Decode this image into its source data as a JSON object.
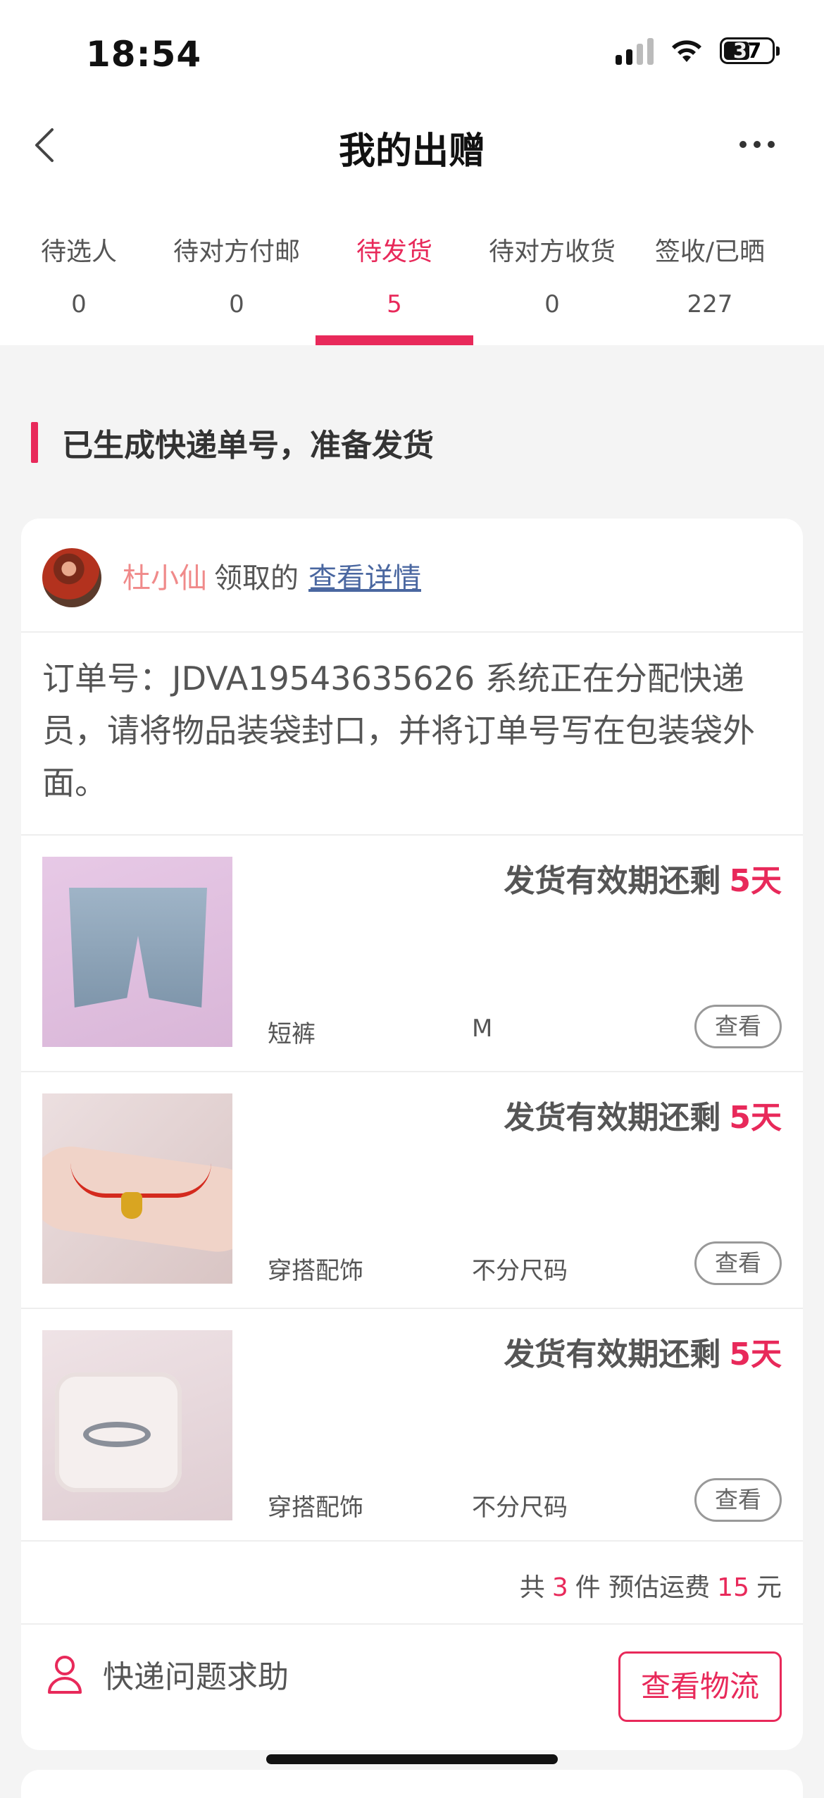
{
  "status_bar": {
    "time": "18:54",
    "battery": "37"
  },
  "nav": {
    "title": "我的出赠"
  },
  "tabs": [
    {
      "label": "待选人",
      "count": "0"
    },
    {
      "label": "待对方付邮",
      "count": "0"
    },
    {
      "label": "待发货",
      "count": "5",
      "active": true
    },
    {
      "label": "待对方收货",
      "count": "0"
    },
    {
      "label": "签收/已晒",
      "count": "227"
    }
  ],
  "section": {
    "title": "已生成快递单号，准备发货"
  },
  "card": {
    "giver_name": "杜小仙",
    "claim_text": "领取的",
    "detail_link": "查看详情",
    "order_info": "订单号：JDVA19543635626 系统正在分配快递员，请将物品装袋封口，并将订单号写在包装袋外面。",
    "items": [
      {
        "deadline_label": "发货有效期还剩",
        "days": "5天",
        "category": "短裤",
        "size": "M",
        "view_label": "查看"
      },
      {
        "deadline_label": "发货有效期还剩",
        "days": "5天",
        "category": "穿搭配饰",
        "size": "不分尺码",
        "view_label": "查看"
      },
      {
        "deadline_label": "发货有效期还剩",
        "days": "5天",
        "category": "穿搭配饰",
        "size": "不分尺码",
        "view_label": "查看"
      }
    ],
    "summary": {
      "prefix": "共",
      "count": "3",
      "unit": "件 预估运费",
      "fee": "15",
      "currency": "元"
    },
    "help_label": "快递问题求助",
    "logistics_button": "查看物流"
  },
  "colors": {
    "accent": "#e8295a",
    "link": "#4a67a0",
    "giver": "#f08a8a"
  }
}
